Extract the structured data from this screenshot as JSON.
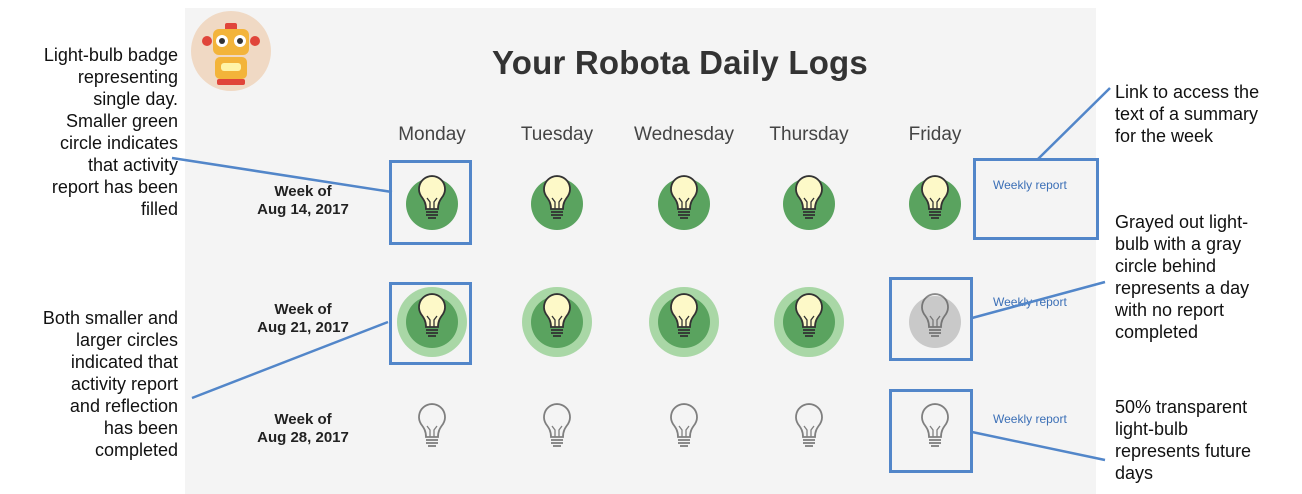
{
  "header": {
    "title": "Your Robota Daily Logs",
    "avatar_icon": "robot-avatar-icon"
  },
  "days": [
    "Monday",
    "Tuesday",
    "Wednesday",
    "Thursday",
    "Friday"
  ],
  "weeks": [
    {
      "line1": "Week of",
      "line2": "Aug 14, 2017",
      "report_link": "Weekly report",
      "states": [
        "report",
        "report",
        "report",
        "report",
        "report"
      ]
    },
    {
      "line1": "Week of",
      "line2": "Aug 21, 2017",
      "report_link": "Weekly report",
      "states": [
        "report-reflection",
        "report-reflection",
        "report-reflection",
        "report-reflection",
        "missed"
      ]
    },
    {
      "line1": "Week of",
      "line2": "Aug 28, 2017",
      "report_link": "Weekly report",
      "states": [
        "future",
        "future",
        "future",
        "future",
        "future"
      ]
    }
  ],
  "colors": {
    "green_inner": "#5aa35f",
    "green_outer": "#a9d7a6",
    "gray_circle": "#c9c9c9",
    "bulb_fill": "#fdf9c8",
    "highlight": "#5286c9",
    "link": "#3b6fb6"
  },
  "annotations": {
    "left_top": [
      "Light-bulb badge",
      "representing",
      "single day.",
      "Smaller green",
      "circle indicates",
      "that activity",
      "report has been",
      "filled"
    ],
    "left_bottom": [
      "Both smaller and",
      "larger circles",
      "indicated that",
      "activity report",
      "and reflection",
      "has been",
      "completed"
    ],
    "right_top": [
      "Link to access the",
      "text of a summary",
      "for the week"
    ],
    "right_mid": [
      "Grayed out light-",
      "bulb with a gray",
      "circle behind",
      "represents a day",
      "with no report",
      "completed"
    ],
    "right_bottom": [
      "50% transparent",
      "light-bulb",
      "represents future",
      "days"
    ]
  }
}
